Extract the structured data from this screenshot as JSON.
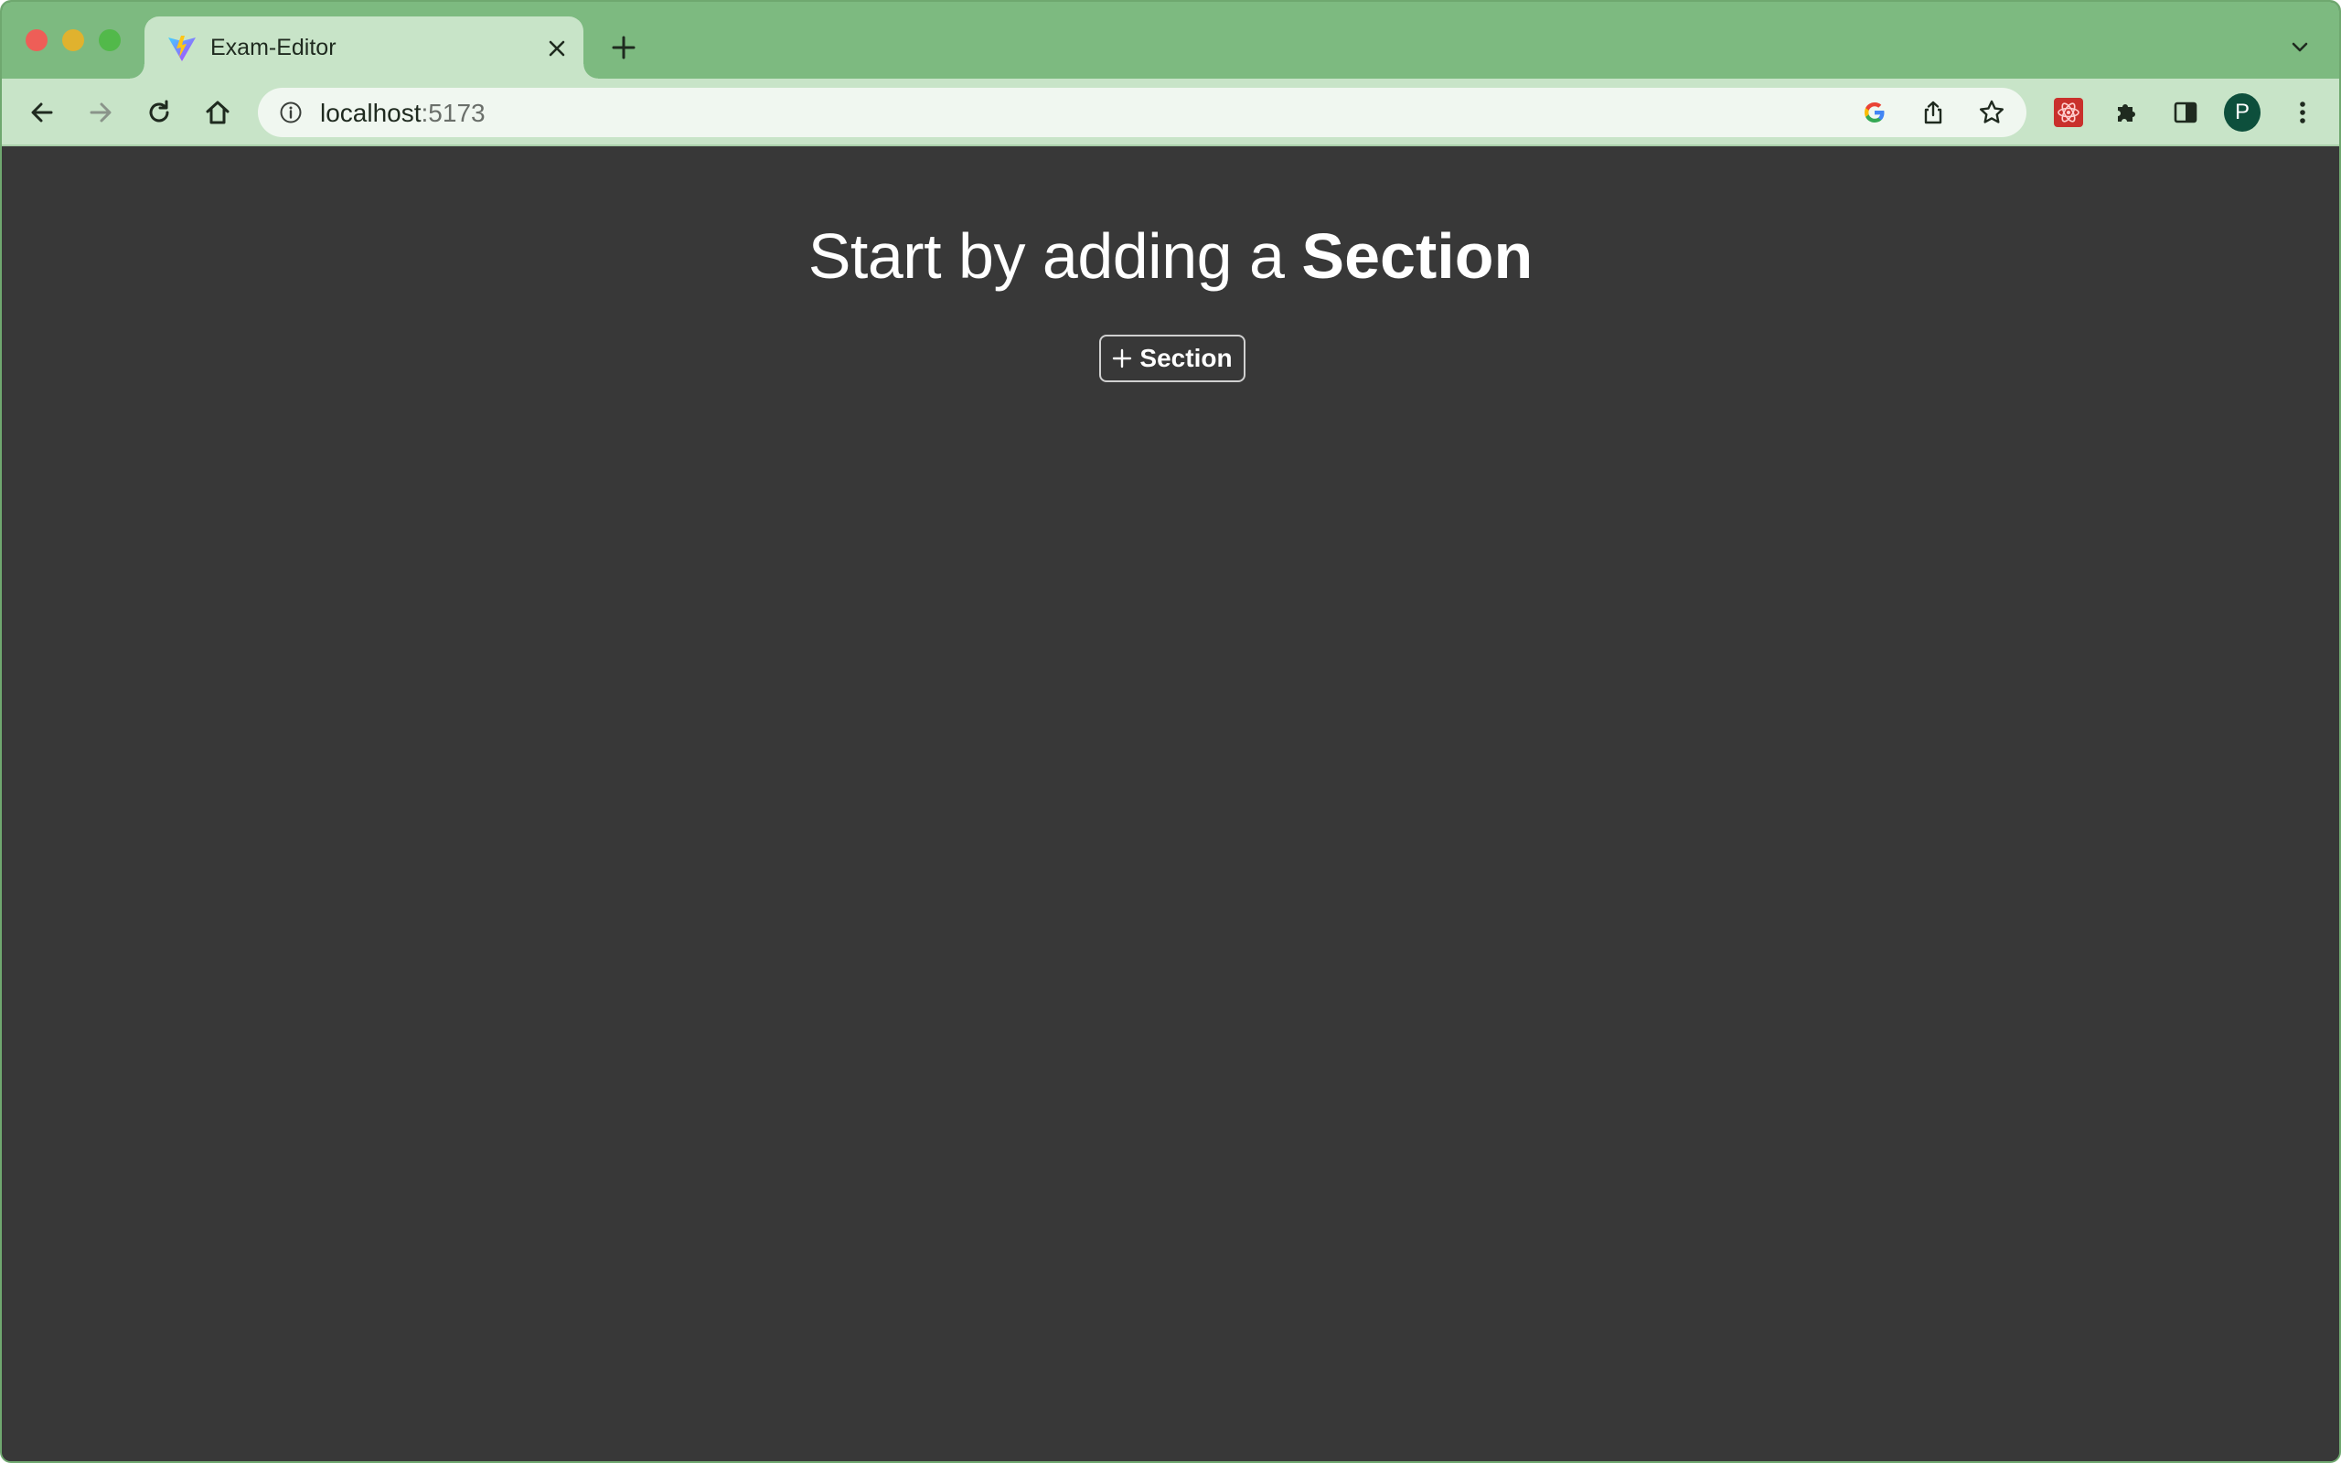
{
  "browser": {
    "tab": {
      "title": "Exam-Editor",
      "favicon": "vite-logo-icon"
    },
    "address": {
      "host": "localhost",
      "port": ":5173"
    },
    "profile_initial": "P",
    "colors": {
      "tabstrip": "#7dba80",
      "toolbar": "#c8e4c8",
      "avatar": "#0d4f3c"
    }
  },
  "page": {
    "headline_light": "Start by adding a ",
    "headline_bold": "Section",
    "add_button_label": "Section",
    "add_button_icon": "plus-icon",
    "background": "#383838"
  }
}
